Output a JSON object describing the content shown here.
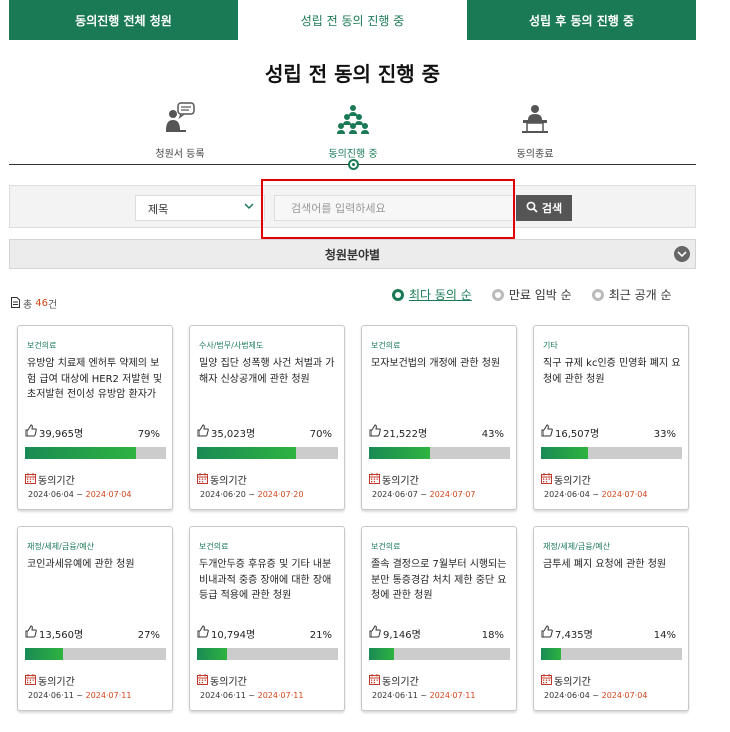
{
  "tabs": [
    {
      "label": "동의진행 전체 청원",
      "active": false
    },
    {
      "label": "성립 전 동의 진행 중",
      "active": true
    },
    {
      "label": "성립 후 동의 진행 중",
      "active": false
    }
  ],
  "page_title": "성립 전 동의 진행 중",
  "steps": [
    {
      "label": "청원서 등록",
      "icon": "person-speech-icon"
    },
    {
      "label": "동의진행 중",
      "icon": "group-people-icon"
    },
    {
      "label": "동의종료",
      "icon": "person-podium-icon"
    }
  ],
  "search": {
    "select_value": "제목",
    "placeholder": "검색어를 입력하세요",
    "button_label": "검색"
  },
  "category_bar": {
    "label": "청원분야별"
  },
  "total": {
    "prefix": "총",
    "count": "46",
    "suffix": "건"
  },
  "sorts": [
    {
      "label": "최다 동의 순",
      "active": true
    },
    {
      "label": "만료 임박 순",
      "active": false
    },
    {
      "label": "최근 공개 순",
      "active": false
    }
  ],
  "period_label": "동의기간",
  "cards": [
    {
      "category": "보건의료",
      "title": "유방암 치료제 엔허투 약제의 보험 급여 대상에 HER2 저발현 및 초저발현 전이성 유방암 환자가",
      "count": "39,965명",
      "percent": "79%",
      "progress": 79,
      "start": "2024·06·04",
      "end": "2024·07·04"
    },
    {
      "category": "수사/법무/사법제도",
      "title": "밀양 집단 성폭행 사건 처벌과 가해자 신상공개에 관한 청원",
      "count": "35,023명",
      "percent": "70%",
      "progress": 70,
      "start": "2024·06·20",
      "end": "2024·07·20"
    },
    {
      "category": "보건의료",
      "title": "모자보건법의 개정에 관한 청원",
      "count": "21,522명",
      "percent": "43%",
      "progress": 43,
      "start": "2024·06·07",
      "end": "2024·07·07"
    },
    {
      "category": "기타",
      "title": "직구 규제 kc인증 민영화 폐지 요청에 관한 청원",
      "count": "16,507명",
      "percent": "33%",
      "progress": 33,
      "start": "2024·06·04",
      "end": "2024·07·04"
    },
    {
      "category": "재정/세제/금융/예산",
      "title": "코인과세유예에 관한 청원",
      "count": "13,560명",
      "percent": "27%",
      "progress": 27,
      "start": "2024·06·11",
      "end": "2024·07·11"
    },
    {
      "category": "보건의료",
      "title": "두개안두증 후유증 및 기타 내분비내과적 중증 장애에 대한 장애등급 적용에 관한 청원",
      "count": "10,794명",
      "percent": "21%",
      "progress": 21,
      "start": "2024·06·11",
      "end": "2024·07·11"
    },
    {
      "category": "보건의료",
      "title": "졸속 결정으로 7월부터 시행되는 분만 통증경감 처치 제한 중단 요청에 관한 청원",
      "count": "9,146명",
      "percent": "18%",
      "progress": 18,
      "start": "2024·06·11",
      "end": "2024·07·11"
    },
    {
      "category": "재정/세제/금융/예산",
      "title": "금투세 폐지 요청에 관한 청원",
      "count": "7,435명",
      "percent": "14%",
      "progress": 14,
      "start": "2024·06·04",
      "end": "2024·07·04"
    }
  ]
}
